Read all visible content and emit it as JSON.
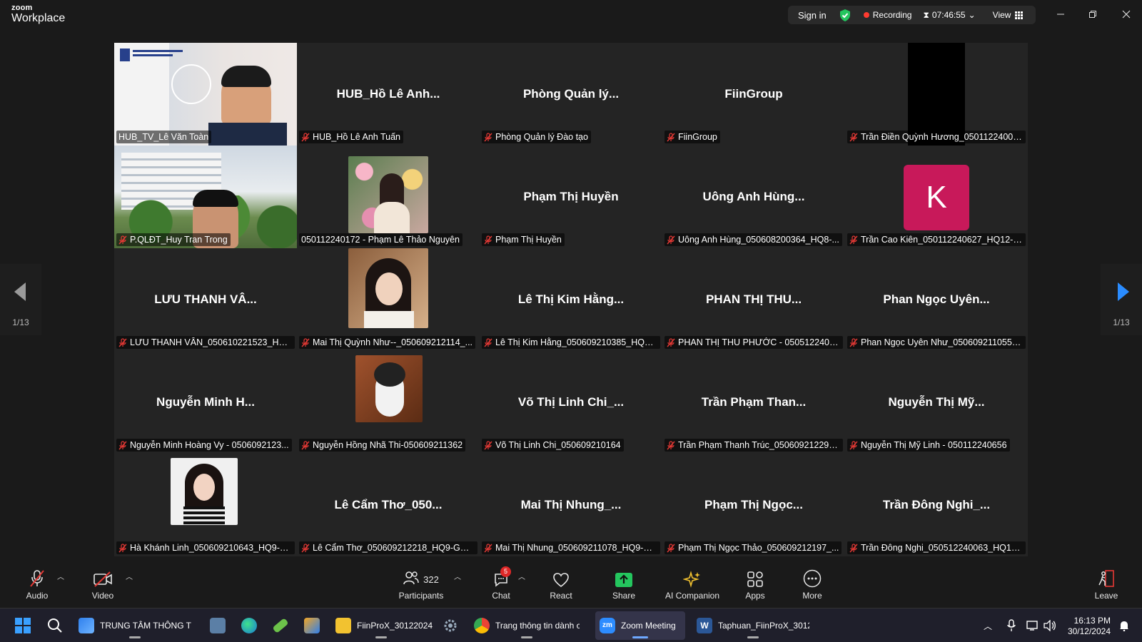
{
  "app": {
    "brand_small": "zoom",
    "brand": "Workplace"
  },
  "topbar": {
    "sign_in": "Sign in",
    "recording": "Recording",
    "timer": "07:46:55",
    "view": "View"
  },
  "gallery": {
    "page_left": "1/13",
    "page_right": "1/13",
    "tiles": [
      {
        "big": "",
        "name": "HUB_TV_Lê Văn Toàn",
        "kind": "video-speaker",
        "muted": false
      },
      {
        "big": "HUB_Hồ Lê Anh...",
        "name": "HUB_Hồ Lê Anh Tuấn",
        "kind": "name",
        "muted": true
      },
      {
        "big": "Phòng Quản lý...",
        "name": "Phòng Quản lý Đào tạo",
        "kind": "name",
        "muted": true
      },
      {
        "big": "FiinGroup",
        "name": "FiinGroup",
        "kind": "name",
        "muted": true
      },
      {
        "big": "",
        "name": "Trần Điền Quỳnh Hương_05011224009...",
        "kind": "black",
        "muted": true
      },
      {
        "big": "",
        "name": "P.QLĐT_Huy Tran Trong",
        "kind": "video-building",
        "muted": true
      },
      {
        "big": "",
        "name": "050112240172 - Phạm Lê Thảo Nguyên",
        "kind": "photo-flowers",
        "muted": false
      },
      {
        "big": "Phạm Thị Huyền",
        "name": "Phạm Thị Huyền",
        "kind": "name",
        "muted": true
      },
      {
        "big": "Uông Anh Hùng...",
        "name": "Uông Anh Hùng_050608200364_HQ8-...",
        "kind": "name",
        "muted": true
      },
      {
        "big": "K",
        "name": "Trần Cao Kiên_050112240627_HQ12-B...",
        "kind": "letter",
        "muted": true
      },
      {
        "big": "LƯU THANH VÂ...",
        "name": "LƯU THANH VÂN_050610221523_HQ1...",
        "kind": "name",
        "muted": true
      },
      {
        "big": "",
        "name": "Mai Thị Quỳnh Như--_050609212114_...",
        "kind": "photo-girl",
        "muted": true
      },
      {
        "big": "Lê Thị Kim Hằng...",
        "name": "Lê Thị Kim Hằng_050609210385_HQ9-...",
        "kind": "name",
        "muted": true
      },
      {
        "big": "PHAN THỊ THU...",
        "name": "PHAN THỊ THU PHƯỚC - 0505122402...",
        "kind": "name",
        "muted": true
      },
      {
        "big": "Phan Ngọc Uyên...",
        "name": "Phan Ngọc Uyên Như_050609211055_...",
        "kind": "name",
        "muted": true
      },
      {
        "big": "Nguyễn Minh H...",
        "name": "Nguyễn Minh Hoàng Vy - 0506092123...",
        "kind": "name",
        "muted": true
      },
      {
        "big": "",
        "name": "Nguyễn Hồng Nhã Thi-050609211362",
        "kind": "photo-dog",
        "muted": true
      },
      {
        "big": "Võ Thị Linh Chi_...",
        "name": "Võ Thị Linh Chi_050609210164",
        "kind": "name",
        "muted": true
      },
      {
        "big": "Trần Phạm Than...",
        "name": "Trần Phạm Thanh Trúc_050609212297_...",
        "kind": "name",
        "muted": true
      },
      {
        "big": "Nguyễn Thị Mỹ...",
        "name": "Nguyễn Thị Mỹ Linh - 050112240656",
        "kind": "name",
        "muted": true
      },
      {
        "big": "",
        "name": "Hà Khánh Linh_050609210643_HQ9-G...",
        "kind": "photo-portrait",
        "muted": true
      },
      {
        "big": "Lê Cẩm Thơ_050...",
        "name": "Lê Cẩm Thơ_050609212218_HQ9-GE12",
        "kind": "name",
        "muted": true
      },
      {
        "big": "Mai Thị Nhung_...",
        "name": "Mai Thị Nhung_050609211078_HQ9-G...",
        "kind": "name",
        "muted": true
      },
      {
        "big": "Phạm Thị Ngọc...",
        "name": "Phạm Thị Ngọc Thảo_050609212197_...",
        "kind": "name",
        "muted": true
      },
      {
        "big": "Trần Đông Nghi_...",
        "name": "Trần Đông Nghi_050512240063_HQ12...",
        "kind": "name",
        "muted": true
      }
    ]
  },
  "toolbar": {
    "audio": "Audio",
    "video": "Video",
    "participants": "Participants",
    "participants_count": "322",
    "chat": "Chat",
    "chat_badge": "5",
    "react": "React",
    "share": "Share",
    "ai": "AI Companion",
    "apps": "Apps",
    "more": "More",
    "leave": "Leave"
  },
  "taskbar": {
    "items": [
      {
        "label": "TRUNG TÂM THÔNG TI"
      },
      {
        "label": "FiinProX_30122024"
      },
      {
        "label": "Trang thông tin dành ch"
      },
      {
        "label": "Zoom Meeting"
      },
      {
        "label": "Taphuan_FiinProX_30122"
      }
    ],
    "time": "16:13 PM",
    "date": "30/12/2024"
  },
  "colors": {
    "accent_green": "#2ad384",
    "recording_red": "#ff3b30",
    "share_green": "#24c65e",
    "letter_avatar": "#c8195a"
  }
}
